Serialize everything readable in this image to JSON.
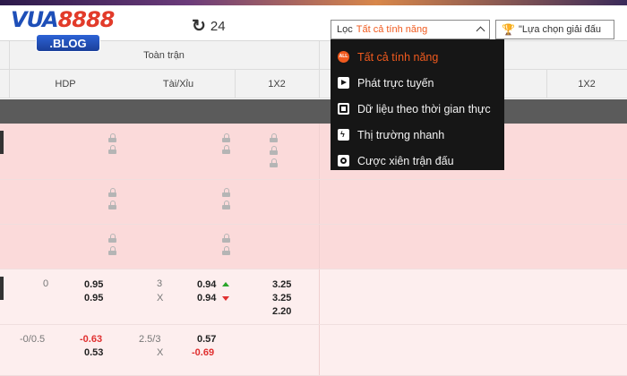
{
  "logo": {
    "brand_main": "VUA",
    "brand_num": "8888",
    "badge": ".BLOG"
  },
  "toolbar": {
    "refresh_icon": "↻",
    "refresh_count": "24",
    "filter_label": "Lọc",
    "filter_value": "Tất cả tính năng",
    "league_button": "\"Lựa chọn giải đấu",
    "trophy_icon": "🏆"
  },
  "table_header": {
    "group_full": "Toàn trận",
    "col_hdp": "HDP",
    "col_taixiu": "Tài/Xỉu",
    "col_1x2": "1X2",
    "col_1x2_right": "1X2"
  },
  "dropdown": {
    "items": [
      {
        "label": "Tất cả tính năng",
        "icon": "all-icon",
        "icon_text": "ALL"
      },
      {
        "label": "Phát trực tuyến",
        "icon": "play-icon"
      },
      {
        "label": "Dữ liệu theo thời gian thực",
        "icon": "live-data-icon"
      },
      {
        "label": "Thị trường nhanh",
        "icon": "lightning-icon"
      },
      {
        "label": "Cược xiên trận đấu",
        "icon": "ticket-icon"
      }
    ]
  },
  "match_rows": [
    {
      "hdp": "0",
      "hdp_home": "0.95",
      "hdp_away": "0.95",
      "ou_line": "3",
      "ou_x": "X",
      "ou_over": "0.94",
      "ou_under": "0.94",
      "x12_1": "3.25",
      "x12_x": "3.25",
      "x12_2": "2.20"
    },
    {
      "hdp": "-0/0.5",
      "hdp_home": "-0.63",
      "hdp_away": "0.53",
      "ou_line": "2.5/3",
      "ou_x": "X",
      "ou_over": "0.57",
      "ou_under": "-0.69"
    }
  ],
  "colors": {
    "accent": "#f05a1e",
    "locked_row": "#fbdada",
    "open_row": "#fdeeee",
    "dropdown_bg": "#161616"
  }
}
